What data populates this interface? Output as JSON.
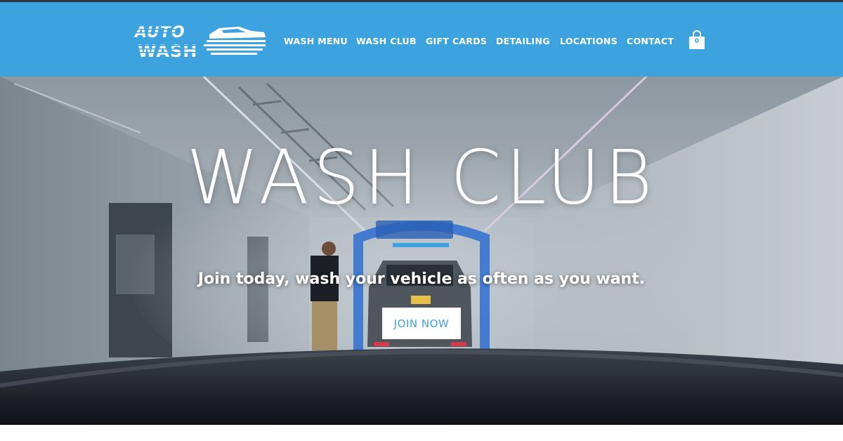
{
  "header": {
    "logo_text": [
      "AUTO",
      "WASH"
    ],
    "nav": [
      {
        "label": "WASH MENU"
      },
      {
        "label": "WASH CLUB"
      },
      {
        "label": "GIFT CARDS"
      },
      {
        "label": "DETAILING"
      },
      {
        "label": "LOCATIONS"
      },
      {
        "label": "CONTACT"
      }
    ],
    "cart": {
      "icon": "shopping-bag-icon",
      "count": "0"
    }
  },
  "hero": {
    "title": "WASH CLUB",
    "subtitle": "Join today, wash your vehicle as often as you want.",
    "cta_label": "JOIN NOW"
  },
  "colors": {
    "brand_blue": "#3da3de",
    "white": "#ffffff"
  }
}
